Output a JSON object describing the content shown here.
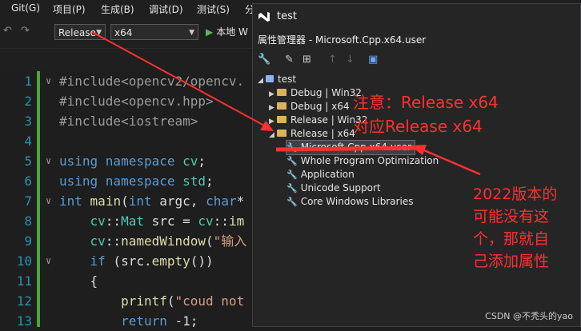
{
  "menubar": {
    "items": [
      "Git(G)",
      "项目(P)",
      "生成(B)",
      "调试(D)",
      "测试(S)",
      "分"
    ]
  },
  "toolbar": {
    "config": "Release",
    "platform": "x64",
    "run_label": "本地 W"
  },
  "editor": {
    "line_numbers": [
      "1",
      "2",
      "3",
      "4",
      "5",
      "6",
      "7",
      "8",
      "9",
      "10",
      "11",
      "12",
      "13"
    ]
  },
  "panel": {
    "window_title": "test",
    "subtitle": "属性管理器 - Microsoft.Cpp.x64.user",
    "tree": {
      "root": "test",
      "configs": [
        {
          "label": "Debug | Win32"
        },
        {
          "label": "Debug | x64"
        },
        {
          "label": "Release | Win32"
        },
        {
          "label": "Release | x64"
        }
      ],
      "sheets": [
        "Microsoft.Cpp.x64.user",
        "Whole Program Optimization",
        "Application",
        "Unicode Support",
        "Core Windows Libraries"
      ]
    }
  },
  "annotations": {
    "note_line1": "注意：Release x64",
    "note_line2": "对应Release x64",
    "side_note": [
      "2022版本的",
      "可能没有这",
      "个，那就自",
      "己添加属性"
    ]
  },
  "watermark": "CSDN @不秃头的yao",
  "colors": {
    "annotation": "#ff3030",
    "keyword": "#569cd6",
    "type": "#4ec9b0",
    "gutter_marker": "#51a33d"
  }
}
